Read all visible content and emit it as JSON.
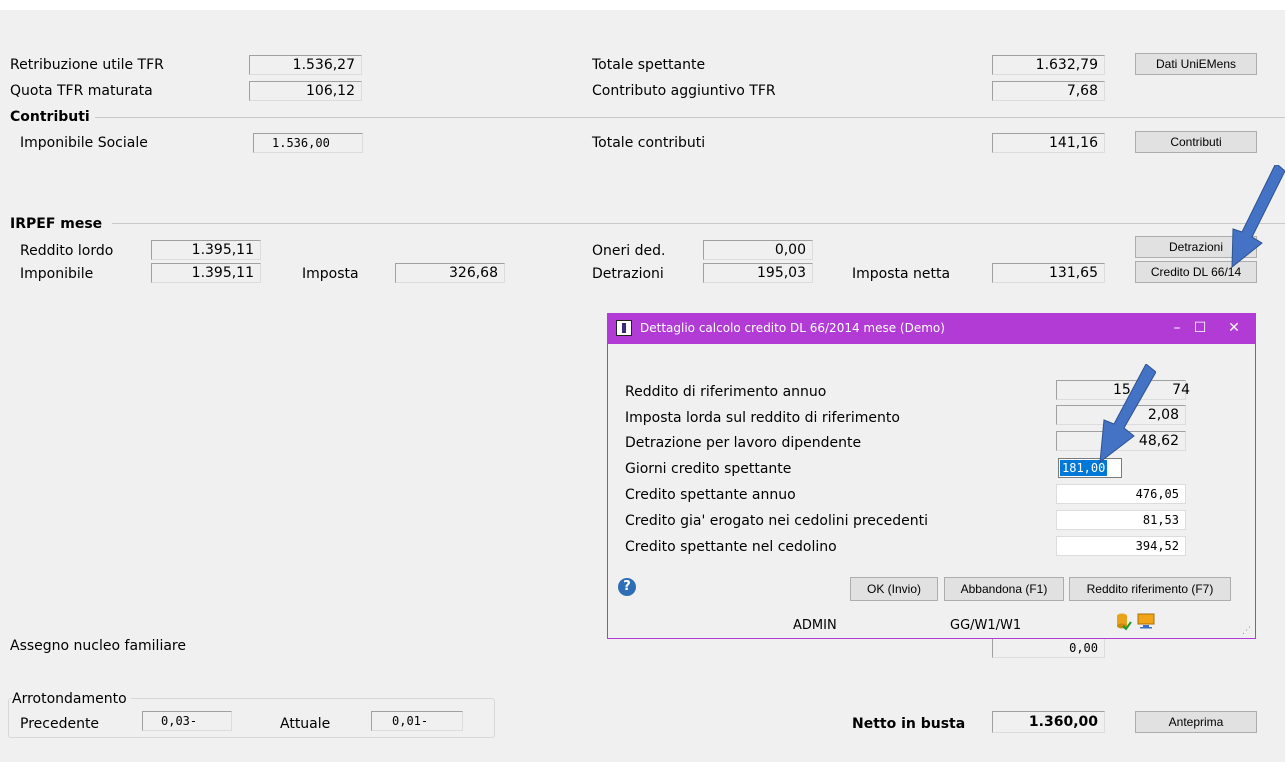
{
  "tfr": {
    "retribuzione_label": "Retribuzione utile TFR",
    "retribuzione_value": "1.536,27",
    "quota_label": "Quota TFR maturata",
    "quota_value": "106,12",
    "totale_spettante_label": "Totale spettante",
    "totale_spettante_value": "1.632,79",
    "contributo_agg_label": "Contributo aggiuntivo TFR",
    "contributo_agg_value": "7,68",
    "uniemens_button": "Dati UniEMens"
  },
  "contributi": {
    "section_title": "Contributi",
    "imponibile_sociale_label": "Imponibile Sociale",
    "imponibile_sociale_value": "1.536,00",
    "totale_contributi_label": "Totale contributi",
    "totale_contributi_value": "141,16",
    "contributi_button": "Contributi"
  },
  "irpef": {
    "section_title": "IRPEF mese",
    "reddito_lordo_label": "Reddito lordo",
    "reddito_lordo_value": "1.395,11",
    "imponibile_label": "Imponibile",
    "imponibile_value": "1.395,11",
    "imposta_label": "Imposta",
    "imposta_value": "326,68",
    "oneri_label": "Oneri ded.",
    "oneri_value": "0,00",
    "detrazioni_label": "Detrazioni",
    "detrazioni_value": "195,03",
    "imposta_netta_label": "Imposta netta",
    "imposta_netta_value": "131,65",
    "detrazioni_button": "Detrazioni",
    "credito_button": "Credito DL 66/14"
  },
  "assegno": {
    "label": "Assegno nucleo familiare",
    "value": "0,00"
  },
  "arrotondamento": {
    "title": "Arrotondamento",
    "precedente_label": "Precedente",
    "precedente_value": "0,03-",
    "attuale_label": "Attuale",
    "attuale_value": "0,01-"
  },
  "netto": {
    "label": "Netto in busta",
    "value": "1.360,00",
    "anteprima_button": "Anteprima"
  },
  "dialog": {
    "title": "Dettaglio calcolo credito DL 66/2014 mese  (Demo)",
    "rows": [
      {
        "label": "Reddito di riferimento annuo",
        "value": "15.0__,74"
      },
      {
        "label": "Imposta lorda sul reddito di riferimento",
        "value": "3_,2,08"
      },
      {
        "label": "Detrazione per lavoro dipendente",
        "value": "_48,62"
      },
      {
        "label": "Giorni credito spettante",
        "value": "181,00"
      },
      {
        "label": "Credito spettante annuo",
        "value": "476,05"
      },
      {
        "label": "Credito gia' erogato nei cedolini precedenti",
        "value": "81,53"
      },
      {
        "label": "Credito spettante nel cedolino",
        "value": "394,52"
      }
    ],
    "visible_values": {
      "reddito": "15.0",
      "reddito_tail": "74",
      "imposta_tail": "2,08",
      "detrazione_tail": "48,62"
    },
    "ok_button": "OK (Invio)",
    "abbandona_button": "Abbandona (F1)",
    "reddito_button": "Reddito riferimento (F7)",
    "status_user": "ADMIN",
    "status_path": "GG/W1/W1"
  },
  "colors": {
    "dialog_accent": "#b23bd6",
    "arrow": "#4472c4",
    "selection": "#0078d7"
  }
}
